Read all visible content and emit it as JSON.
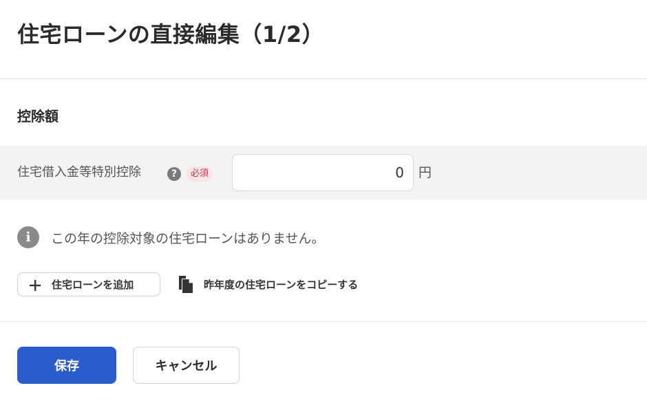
{
  "header": {
    "title": "住宅ローンの直接編集（1/2）"
  },
  "section": {
    "heading": "控除額"
  },
  "deduction_field": {
    "label": "住宅借入金等特別控除",
    "help_icon": "question-circle-icon",
    "help_glyph": "?",
    "required_badge": "必須",
    "value": "0",
    "unit": "円"
  },
  "info": {
    "icon": "info-circle-icon",
    "glyph": "i",
    "message": "この年の控除対象の住宅ローンはありません。"
  },
  "actions": {
    "add_icon": "plus-icon",
    "add_glyph": "＋",
    "add_label": "住宅ローンを追加",
    "copy_icon": "document-copy-icon",
    "copy_label": "昨年度の住宅ローンをコピーする"
  },
  "footer": {
    "save_label": "保存",
    "cancel_label": "キャンセル"
  },
  "colors": {
    "primary": "#2b5ccc",
    "required_bg": "#fbe3e6",
    "required_text": "#c83848",
    "row_bg": "#f4f2f2",
    "icon_gray": "#8a8a8a"
  }
}
